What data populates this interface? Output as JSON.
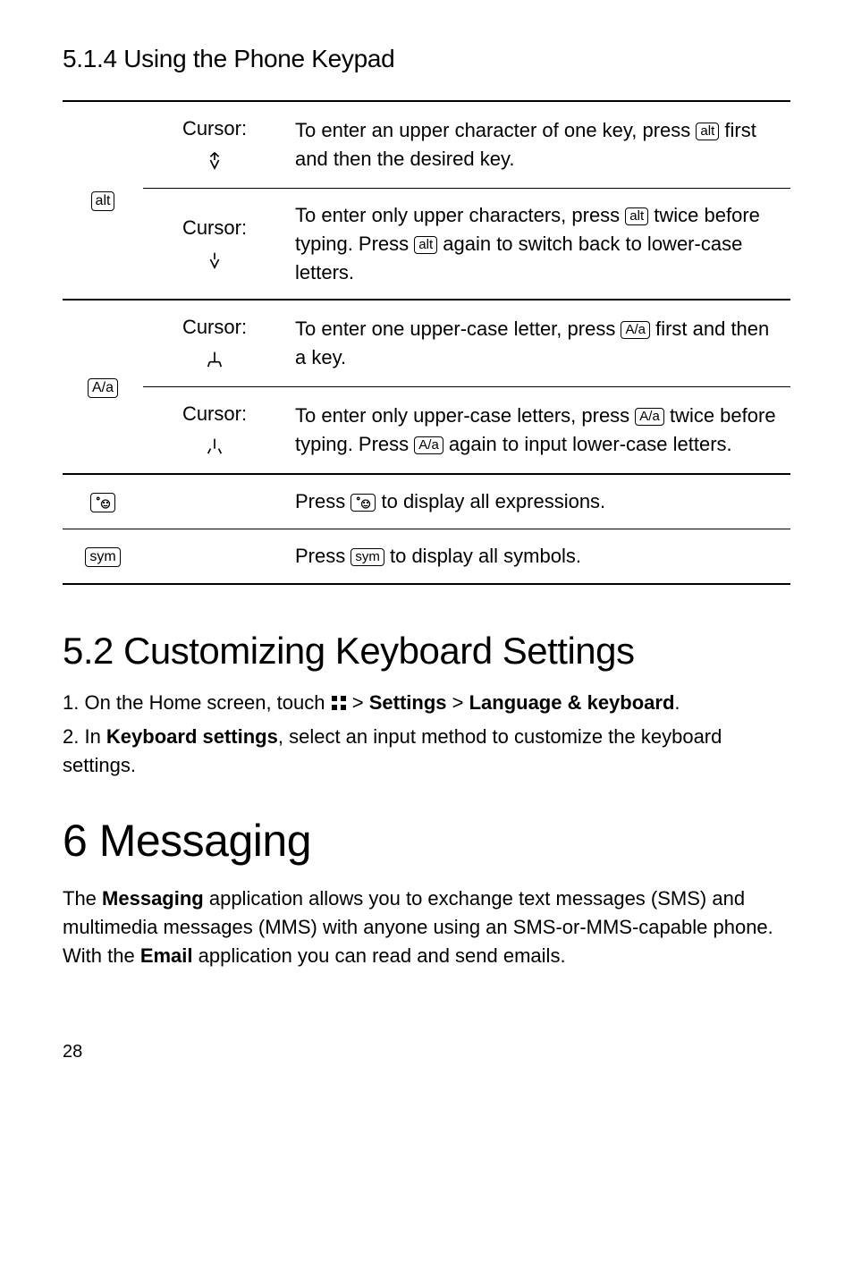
{
  "section_5_1_4": {
    "title": "5.1.4  Using the Phone Keypad"
  },
  "table": {
    "cursor_label": "Cursor:",
    "keys": {
      "alt": "alt",
      "Aa": "A/a",
      "sym": "sym"
    },
    "row1": {
      "p1": "To enter an upper character of one key, press ",
      "p2": " first and then the desired key."
    },
    "row2": {
      "p1": "To enter only upper characters, press ",
      "p2": " twice before typing. Press ",
      "p3": " again to switch back to lower-case letters."
    },
    "row3": {
      "p1": "To enter one upper-case letter, press ",
      "p2": " first and then a key."
    },
    "row4": {
      "p1": "To enter only upper-case letters, press ",
      "p2": " twice before typing. Press ",
      "p3": " again to input lower-case letters."
    },
    "row5": {
      "p1": "Press ",
      "p2": " to display all expressions."
    },
    "row6": {
      "p1": "Press ",
      "p2": " to display all symbols."
    }
  },
  "section_5_2": {
    "title": "5.2  Customizing Keyboard Settings",
    "step1_a": "1. On the Home screen, touch ",
    "step1_b": "  > ",
    "step1_settings": "Settings",
    "step1_c": " > ",
    "step1_lang": "Language & keyboard",
    "step1_d": ".",
    "step2_a": "2. In ",
    "step2_b": "Keyboard settings",
    "step2_c": ", select an input method to customize the keyboard settings."
  },
  "chapter_6": {
    "title": "6  Messaging",
    "p_a": "The ",
    "p_msg": "Messaging",
    "p_b": " application allows you to exchange text messages (SMS) and multimedia messages (MMS) with anyone using an SMS-or-MMS-capable phone. With the ",
    "p_email": "Email",
    "p_c": " application you can read and send emails."
  },
  "page_number": "28"
}
